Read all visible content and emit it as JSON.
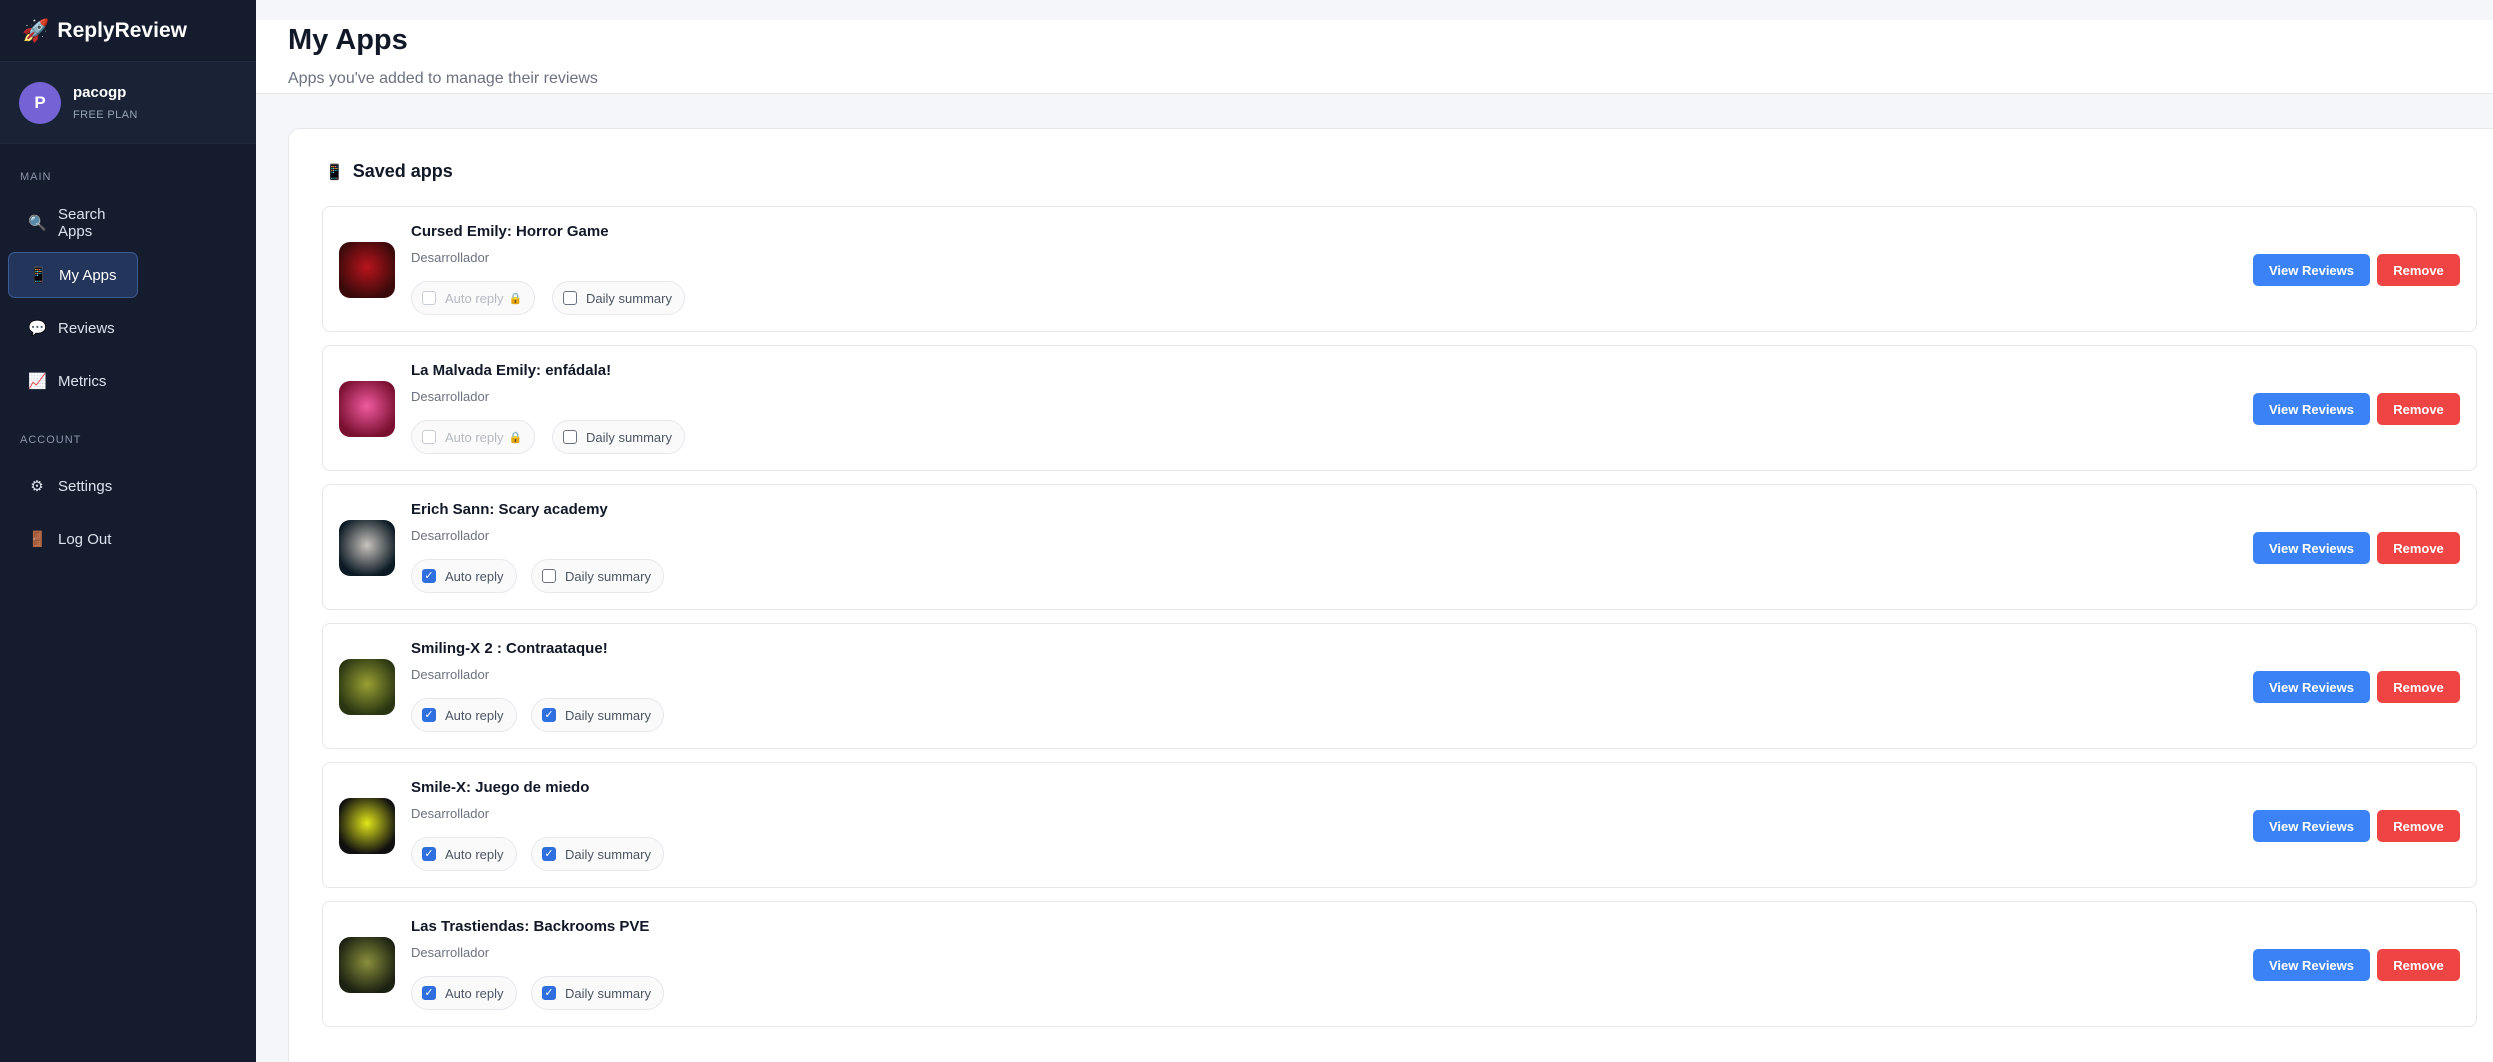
{
  "brand": {
    "icon": "rocket-icon",
    "name": "ReplyReview"
  },
  "user": {
    "initial": "P",
    "name": "pacogp",
    "plan": "FREE PLAN"
  },
  "nav": {
    "main_label": "MAIN",
    "account_label": "ACCOUNT",
    "items": [
      {
        "label": "Search Apps",
        "icon": "🔍",
        "icon_name": "search-icon",
        "active": false
      },
      {
        "label": "My Apps",
        "icon": "📱",
        "icon_name": "phone-icon",
        "active": true
      },
      {
        "label": "Reviews",
        "icon": "💬",
        "icon_name": "speech-bubble-icon",
        "active": false
      },
      {
        "label": "Metrics",
        "icon": "📈",
        "icon_name": "chart-icon",
        "active": false
      },
      {
        "label": "Settings",
        "icon": "⚙",
        "icon_name": "gear-icon",
        "active": false
      },
      {
        "label": "Log Out",
        "icon": "🚪",
        "icon_name": "door-icon",
        "active": false
      }
    ]
  },
  "header": {
    "title": "My Apps",
    "subtitle": "Apps you've added to manage their reviews"
  },
  "saved": {
    "title": "Saved apps",
    "title_icon": "📱",
    "auto_reply_label": "Auto reply",
    "daily_summary_label": "Daily summary",
    "view_label": "View Reviews",
    "remove_label": "Remove",
    "apps": [
      {
        "name": "Cursed Emily: Horror Game",
        "developer": "Desarrollador",
        "auto_reply": false,
        "auto_reply_locked": true,
        "daily_summary": false,
        "colors": [
          "#3a0a0a",
          "#b8141c"
        ]
      },
      {
        "name": "La Malvada Emily: enfádala!",
        "developer": "Desarrollador",
        "auto_reply": false,
        "auto_reply_locked": true,
        "daily_summary": false,
        "colors": [
          "#7a1030",
          "#f05aa0"
        ]
      },
      {
        "name": "Erich Sann: Scary academy",
        "developer": "Desarrollador",
        "auto_reply": true,
        "auto_reply_locked": false,
        "daily_summary": false,
        "colors": [
          "#0b1a24",
          "#c9c3bd"
        ]
      },
      {
        "name": "Smiling-X 2 : Contraataque!",
        "developer": "Desarrollador",
        "auto_reply": true,
        "auto_reply_locked": false,
        "daily_summary": true,
        "colors": [
          "#2a3612",
          "#9aa033"
        ]
      },
      {
        "name": "Smile-X: Juego de miedo",
        "developer": "Desarrollador",
        "auto_reply": true,
        "auto_reply_locked": false,
        "daily_summary": true,
        "colors": [
          "#101010",
          "#e2e61a"
        ]
      },
      {
        "name": "Las Trastiendas: Backrooms PVE",
        "developer": "Desarrollador",
        "auto_reply": true,
        "auto_reply_locked": false,
        "daily_summary": true,
        "colors": [
          "#1c2211",
          "#8a8f3c"
        ]
      }
    ]
  }
}
